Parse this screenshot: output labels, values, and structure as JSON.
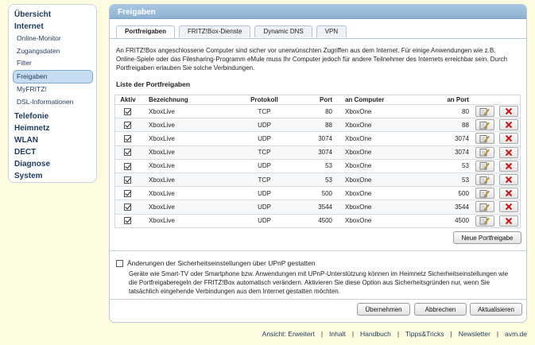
{
  "sidebar": {
    "items": [
      {
        "label": "Übersicht",
        "level": "top"
      },
      {
        "label": "Internet",
        "level": "top"
      },
      {
        "label": "Online-Monitor",
        "level": "sub"
      },
      {
        "label": "Zugangsdaten",
        "level": "sub"
      },
      {
        "label": "Filter",
        "level": "sub"
      },
      {
        "label": "Freigaben",
        "level": "sub",
        "active": true
      },
      {
        "label": "MyFRITZ!",
        "level": "sub"
      },
      {
        "label": "DSL-Informationen",
        "level": "sub"
      },
      {
        "label": "Telefonie",
        "level": "top"
      },
      {
        "label": "Heimnetz",
        "level": "top"
      },
      {
        "label": "WLAN",
        "level": "top"
      },
      {
        "label": "DECT",
        "level": "top"
      },
      {
        "label": "Diagnose",
        "level": "top"
      },
      {
        "label": "System",
        "level": "top"
      }
    ]
  },
  "panel": {
    "title": "Freigaben",
    "tabs": [
      "Portfreigaben",
      "FRITZ!Box-Dienste",
      "Dynamic DNS",
      "VPN"
    ],
    "active_tab": "Portfreigaben",
    "intro_text": "An FRITZ!Box angeschlossene Computer sind sicher vor unerwünschten Zugriffen aus dem Internet. Für einige Anwendungen wie z.B. Online-Spiele oder das Filesharing-Programm eMule muss Ihr Computer jedoch für andere Teilnehmer des Internets erreichbar sein. Durch Portfreigaben erlauben Sie solche Verbindungen.",
    "list_title": "Liste der Portfreigaben"
  },
  "table": {
    "headers": {
      "aktiv": "Aktiv",
      "bezeichnung": "Bezeichnung",
      "protokoll": "Protokoll",
      "port": "Port",
      "computer": "an Computer",
      "an_port": "an Port"
    },
    "rows": [
      {
        "checked": true,
        "name": "XboxLive",
        "protocol": "TCP",
        "port": "80",
        "computer": "XboxOne",
        "to_port": "80"
      },
      {
        "checked": true,
        "name": "XboxLive",
        "protocol": "UDP",
        "port": "88",
        "computer": "XboxOne",
        "to_port": "88"
      },
      {
        "checked": true,
        "name": "XboxLive",
        "protocol": "UDP",
        "port": "3074",
        "computer": "XboxOne",
        "to_port": "3074"
      },
      {
        "checked": true,
        "name": "XboxLive",
        "protocol": "TCP",
        "port": "3074",
        "computer": "XboxOne",
        "to_port": "3074"
      },
      {
        "checked": true,
        "name": "XboxLive",
        "protocol": "UDP",
        "port": "53",
        "computer": "XboxOne",
        "to_port": "53"
      },
      {
        "checked": true,
        "name": "XboxLive",
        "protocol": "TCP",
        "port": "53",
        "computer": "XboxOne",
        "to_port": "53"
      },
      {
        "checked": true,
        "name": "XboxLive",
        "protocol": "UDP",
        "port": "500",
        "computer": "XboxOne",
        "to_port": "500"
      },
      {
        "checked": true,
        "name": "XboxLive",
        "protocol": "UDP",
        "port": "3544",
        "computer": "XboxOne",
        "to_port": "3544"
      },
      {
        "checked": true,
        "name": "XboxLive",
        "protocol": "UDP",
        "port": "4500",
        "computer": "XboxOne",
        "to_port": "4500"
      }
    ]
  },
  "buttons": {
    "new_share": "Neue Portfreigabe",
    "apply": "Übernehmen",
    "cancel": "Abbrechen",
    "refresh": "Aktualisieren"
  },
  "upnp": {
    "label": "Änderungen der Sicherheitseinstellungen über UPnP gestatten",
    "checked": false,
    "description": "Geräte wie Smart-TV oder Smartphone bzw. Anwendungen mit UPnP-Unterstützung können im Heimnetz Sicherheitseinstellungen wie die Portfreigaberegeln der FRITZ!Box automatisch verändern. Aktivieren Sie diese Option aus Sicherheitsgründen nur, wenn Sie tatsächlich eingehende Verbindungen aus dem Internet gestatten möchten."
  },
  "footer": {
    "links": [
      "Ansicht: Erweitert",
      "Inhalt",
      "Handbuch",
      "Tipps&Tricks",
      "Newsletter",
      "avm.de"
    ]
  },
  "icons": {
    "edit": "edit-icon",
    "delete": "delete-icon"
  },
  "colors": {
    "background": "#fdfce0",
    "header": "#97b8d6",
    "delete_red": "#cc1a1a",
    "nav_text": "#1e3a5c"
  }
}
